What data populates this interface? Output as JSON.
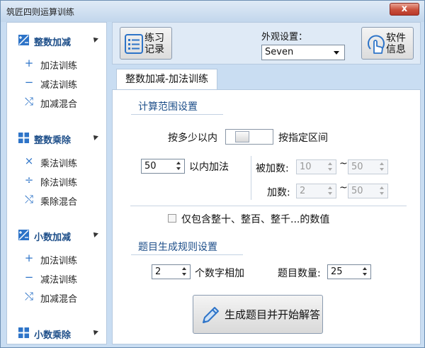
{
  "window": {
    "title": "筑匠四则运算训练",
    "close_label": "x"
  },
  "sidebar": {
    "groups": [
      {
        "title": "整数加减",
        "icon": "plus-minus-grid-icon",
        "items": [
          {
            "label": "加法训练",
            "icon": "plus-icon"
          },
          {
            "label": "减法训练",
            "icon": "minus-icon"
          },
          {
            "label": "加减混合",
            "icon": "shuffle-icon"
          }
        ]
      },
      {
        "title": "整数乘除",
        "icon": "grid-icon",
        "items": [
          {
            "label": "乘法训练",
            "icon": "times-icon"
          },
          {
            "label": "除法训练",
            "icon": "divide-icon"
          },
          {
            "label": "乘除混合",
            "icon": "shuffle-icon"
          }
        ]
      },
      {
        "title": "小数加减",
        "icon": "plus-minus-grid-icon",
        "items": [
          {
            "label": "加法训练",
            "icon": "plus-icon"
          },
          {
            "label": "减法训练",
            "icon": "minus-icon"
          },
          {
            "label": "加减混合",
            "icon": "shuffle-icon"
          }
        ]
      },
      {
        "title": "小数乘除",
        "icon": "grid-icon",
        "items": []
      }
    ]
  },
  "toolbar": {
    "practice_record_label": "练习\n记录",
    "appearance_label": "外观设置：",
    "appearance_value": "Seven",
    "software_info_label": "软件\n信息"
  },
  "tab": {
    "label": "整数加减-加法训练"
  },
  "range_settings": {
    "title": "计算范围设置",
    "within_label": "按多少以内",
    "interval_label": "按指定区间",
    "within_value": "50",
    "within_suffix": "以内加法",
    "augend_label": "被加数:",
    "augend_min": "10",
    "augend_max": "50",
    "addend_label": "加数:",
    "addend_min": "2",
    "addend_max": "50",
    "tilde": "~",
    "whole_only_label": "仅包含整十、整百、整千...的数值"
  },
  "rule_settings": {
    "title": "题目生成规则设置",
    "numbers_value": "2",
    "numbers_label": "个数字相加",
    "count_label": "题目数量:",
    "count_value": "25"
  },
  "generate_button": {
    "label": "生成题目并开始解答"
  },
  "colors": {
    "accent": "#2e74c8",
    "heading": "#1d4e89",
    "window_bg": "#c9ddf2"
  }
}
